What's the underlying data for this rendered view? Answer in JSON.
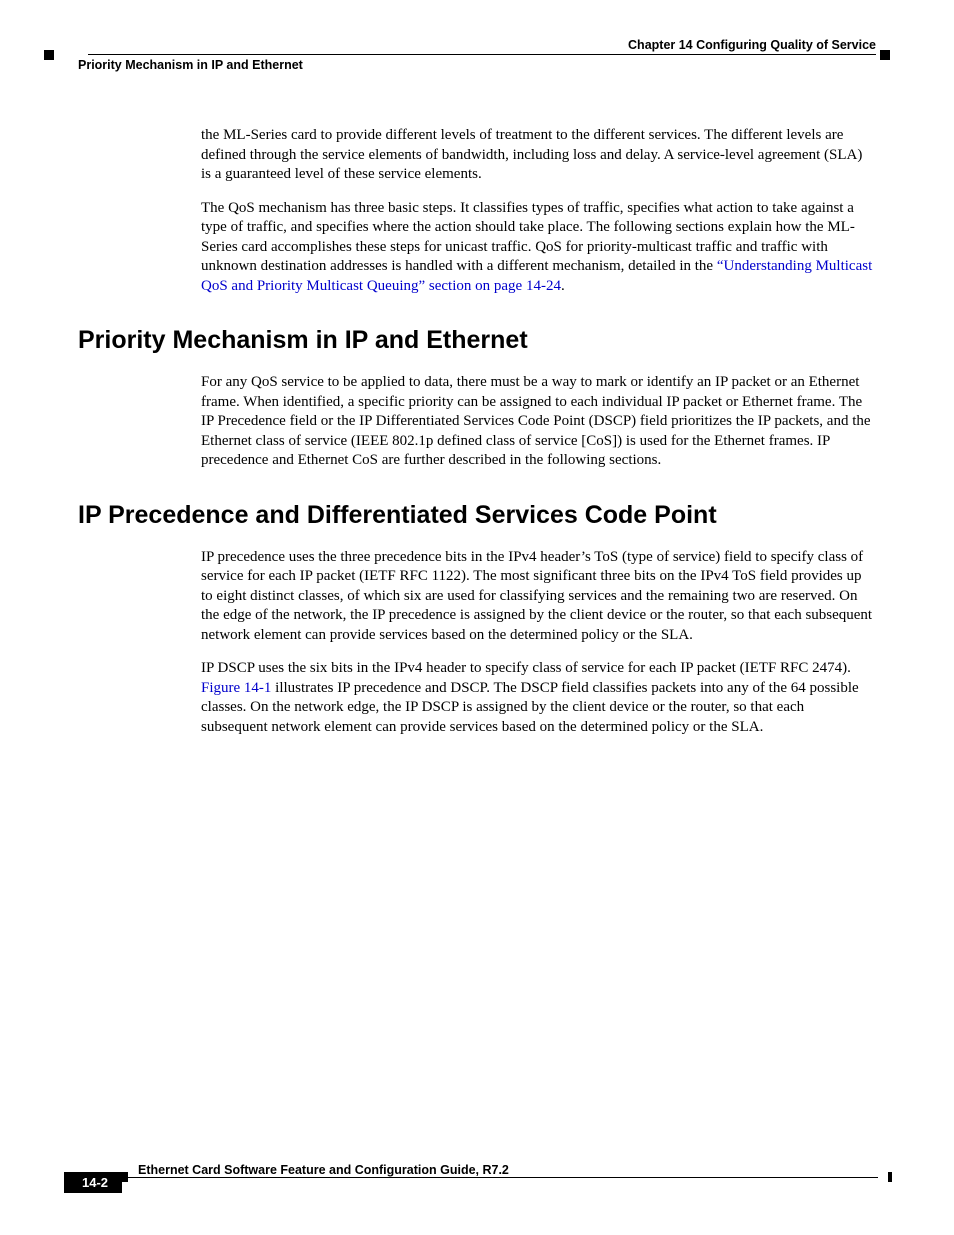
{
  "header": {
    "chapter": "Chapter 14 Configuring Quality of Service",
    "section": "Priority Mechanism in IP and Ethernet"
  },
  "intro": {
    "p1": "the ML-Series card to provide different levels of treatment to the different services. The different levels are defined through the service elements of bandwidth, including loss and delay. A service-level agreement (SLA) is a guaranteed level of these service elements.",
    "p2_pre": "The QoS mechanism has three basic steps. It classifies types of traffic, specifies what action to take against a type of traffic, and specifies where the action should take place. The following sections explain how the ML-Series card accomplishes these steps for unicast traffic. QoS for priority-multicast traffic and traffic with unknown destination addresses is handled with a different mechanism, detailed in the ",
    "p2_link": "“Understanding Multicast QoS and Priority Multicast Queuing” section on page 14-24",
    "p2_post": "."
  },
  "sec1": {
    "title": "Priority Mechanism in IP and Ethernet",
    "p1": "For any QoS service to be applied to data, there must be a way to mark or identify an IP packet or an Ethernet frame. When identified, a specific priority can be assigned to each individual IP packet or Ethernet frame. The IP Precedence field or the IP Differentiated Services Code Point (DSCP) field prioritizes the IP packets, and the Ethernet class of service (IEEE 802.1p defined class of service [CoS]) is used for the Ethernet frames. IP precedence and Ethernet CoS are further described in the following sections."
  },
  "sec2": {
    "title": "IP Precedence and Differentiated Services Code Point",
    "p1": "IP precedence uses the three precedence bits in the IPv4 header’s ToS (type of service) field to specify class of service for each IP packet (IETF RFC 1122). The most significant three bits on the IPv4 ToS field provides up to eight distinct classes, of which six are used for classifying services and the remaining two are reserved. On the edge of the network, the IP precedence is assigned by the client device or the router, so that each subsequent network element can provide services based on the determined policy or the SLA.",
    "p2_pre": "IP DSCP uses the six bits in the IPv4 header to specify class of service for each IP packet (IETF RFC 2474). ",
    "p2_link": "Figure 14-1",
    "p2_post": " illustrates IP precedence and DSCP. The DSCP field classifies packets into any of the 64 possible classes. On the network edge, the IP DSCP is assigned by the client device or the router, so that each subsequent network element can provide services based on the determined policy or the SLA."
  },
  "footer": {
    "title": "Ethernet Card Software Feature and Configuration Guide, R7.2",
    "page": "14-2"
  }
}
